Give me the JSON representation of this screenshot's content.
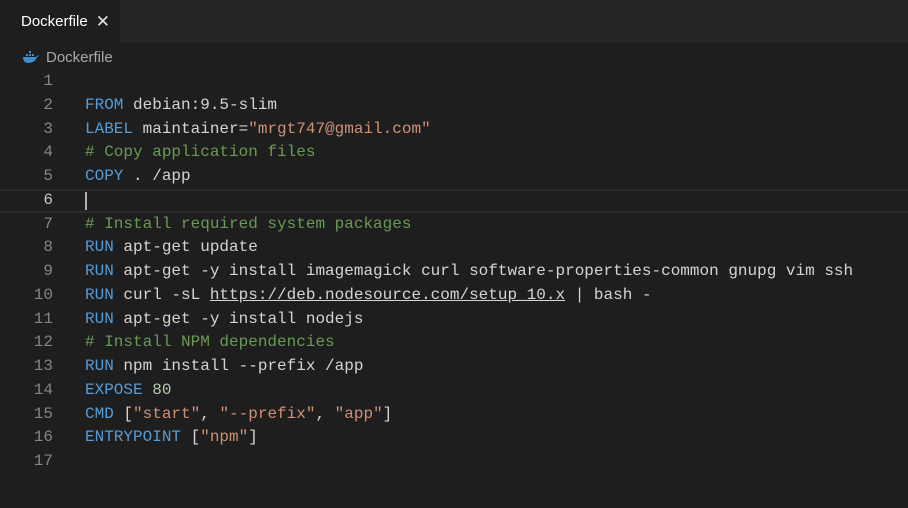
{
  "tab": {
    "label": "Dockerfile",
    "close": "✕",
    "icon": "docker-icon"
  },
  "breadcrumb": {
    "label": "Dockerfile",
    "icon": "docker-icon"
  },
  "editor": {
    "current_line": 6,
    "lines": [
      {
        "n": "1",
        "tokens": []
      },
      {
        "n": "2",
        "tokens": [
          {
            "t": "FROM",
            "c": "kw"
          },
          {
            "t": " debian:9.5-slim",
            "c": "txt"
          }
        ]
      },
      {
        "n": "3",
        "tokens": [
          {
            "t": "LABEL",
            "c": "kw"
          },
          {
            "t": " maintainer=",
            "c": "txt"
          },
          {
            "t": "\"mrgt747@gmail.com\"",
            "c": "str"
          }
        ]
      },
      {
        "n": "4",
        "tokens": [
          {
            "t": "# Copy application files",
            "c": "cm"
          }
        ]
      },
      {
        "n": "5",
        "tokens": [
          {
            "t": "COPY",
            "c": "kw"
          },
          {
            "t": " . /app",
            "c": "txt"
          }
        ]
      },
      {
        "n": "6",
        "tokens": []
      },
      {
        "n": "7",
        "tokens": [
          {
            "t": "# Install required system packages",
            "c": "cm"
          }
        ]
      },
      {
        "n": "8",
        "tokens": [
          {
            "t": "RUN",
            "c": "kw"
          },
          {
            "t": " apt-get update",
            "c": "txt"
          }
        ]
      },
      {
        "n": "9",
        "tokens": [
          {
            "t": "RUN",
            "c": "kw"
          },
          {
            "t": " apt-get -y install imagemagick curl software-properties-common gnupg vim ssh",
            "c": "txt"
          }
        ]
      },
      {
        "n": "10",
        "tokens": [
          {
            "t": "RUN",
            "c": "kw"
          },
          {
            "t": " curl -sL ",
            "c": "txt"
          },
          {
            "t": "https://deb.nodesource.com/setup_10.x",
            "c": "link"
          },
          {
            "t": " | bash -",
            "c": "txt"
          }
        ]
      },
      {
        "n": "11",
        "tokens": [
          {
            "t": "RUN",
            "c": "kw"
          },
          {
            "t": " apt-get -y install nodejs",
            "c": "txt"
          }
        ]
      },
      {
        "n": "12",
        "tokens": [
          {
            "t": "# Install NPM dependencies",
            "c": "cm"
          }
        ]
      },
      {
        "n": "13",
        "tokens": [
          {
            "t": "RUN",
            "c": "kw"
          },
          {
            "t": " npm install --prefix /app",
            "c": "txt"
          }
        ]
      },
      {
        "n": "14",
        "tokens": [
          {
            "t": "EXPOSE",
            "c": "kw"
          },
          {
            "t": " ",
            "c": "txt"
          },
          {
            "t": "80",
            "c": "num"
          }
        ]
      },
      {
        "n": "15",
        "tokens": [
          {
            "t": "CMD",
            "c": "kw"
          },
          {
            "t": " [",
            "c": "txt"
          },
          {
            "t": "\"start\"",
            "c": "str"
          },
          {
            "t": ", ",
            "c": "txt"
          },
          {
            "t": "\"--prefix\"",
            "c": "str"
          },
          {
            "t": ", ",
            "c": "txt"
          },
          {
            "t": "\"app\"",
            "c": "str"
          },
          {
            "t": "]",
            "c": "txt"
          }
        ]
      },
      {
        "n": "16",
        "tokens": [
          {
            "t": "ENTRYPOINT",
            "c": "kw"
          },
          {
            "t": " [",
            "c": "txt"
          },
          {
            "t": "\"npm\"",
            "c": "str"
          },
          {
            "t": "]",
            "c": "txt"
          }
        ]
      },
      {
        "n": "17",
        "tokens": []
      }
    ]
  }
}
